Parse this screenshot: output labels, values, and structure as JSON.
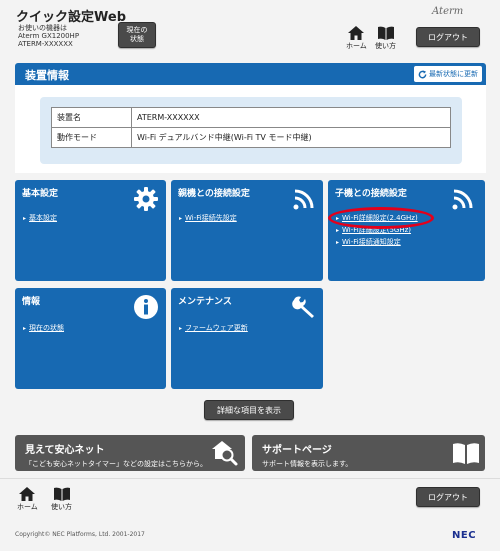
{
  "header": {
    "app_title": "クイック設定Web",
    "device_caption": "お使いの機器は",
    "device_model": "Aterm GX1200HP",
    "device_name": "ATERM-XXXXXX",
    "status_button": "現在の\n状態",
    "brand": "Aterm",
    "home_label": "ホーム",
    "help_label": "使い方",
    "logout_label": "ログアウト"
  },
  "panel": {
    "title": "装置情報",
    "refresh_label": "最新状態に更新",
    "rows": [
      {
        "key": "装置名",
        "value": "ATERM-XXXXXX"
      },
      {
        "key": "動作モード",
        "value": "Wi-Fi デュアルバンド中継(Wi-Fi TV モード中継)"
      }
    ]
  },
  "tiles": {
    "basic": {
      "title": "基本設定",
      "links": [
        "基本設定"
      ],
      "icon": "gear-icon"
    },
    "parent": {
      "title": "親機との接続設定",
      "links": [
        "Wi-Fi接続先設定"
      ],
      "icon": "wifi-icon"
    },
    "child": {
      "title": "子機との接続設定",
      "links": [
        "Wi-Fi詳細設定(2.4GHz)",
        "Wi-Fi詳細設定(5GHz)",
        "Wi-Fi接続通知設定"
      ],
      "icon": "wifi-icon"
    },
    "info": {
      "title": "情報",
      "links": [
        "現在の状態"
      ],
      "icon": "info-icon"
    },
    "maintenance": {
      "title": "メンテナンス",
      "links": [
        "ファームウェア更新"
      ],
      "icon": "wrench-icon"
    }
  },
  "detail_button": "詳細な項目を表示",
  "banners": {
    "safe_net": {
      "title": "見えて安心ネット",
      "desc": "「こども安心ネットタイマー」などの設定はこちらから。"
    },
    "support": {
      "title": "サポートページ",
      "desc": "サポート情報を表示します。"
    }
  },
  "footer": {
    "home_label": "ホーム",
    "help_label": "使い方",
    "logout_label": "ログアウト",
    "copyright": "Copyright© NEC Platforms, Ltd. 2001-2017",
    "logo": "NEC"
  },
  "colors": {
    "accent": "#1769b2",
    "dark_button": "#4a4a4a",
    "banner": "#555555",
    "highlight": "#e3001b"
  }
}
